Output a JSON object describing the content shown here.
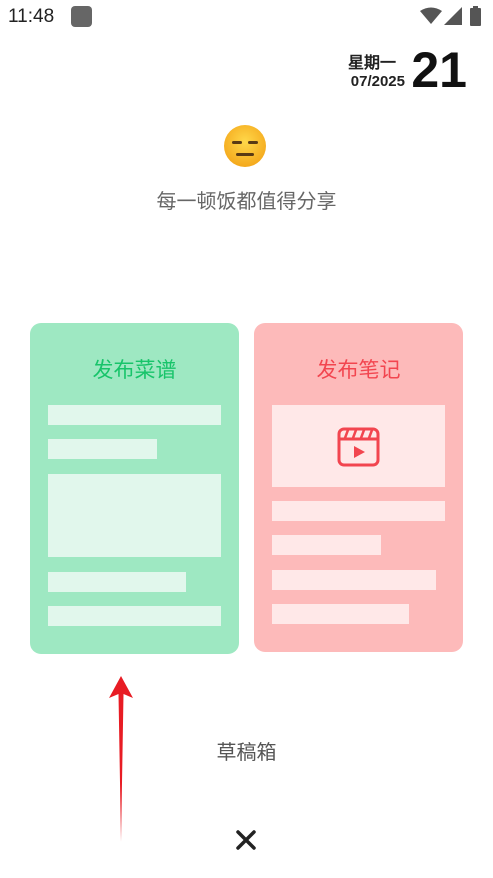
{
  "status_bar": {
    "time": "11:48",
    "icons": [
      "app-notification-icon",
      "wifi-icon",
      "signal-icon",
      "battery-icon"
    ]
  },
  "date": {
    "day_of_week": "星期一",
    "month_year": "07/2025",
    "day_number": "21"
  },
  "header": {
    "emoji": "expressionless-face-icon",
    "tagline": "每一顿饭都值得分享"
  },
  "cards": [
    {
      "title": "发布菜谱",
      "color": "#18c46a",
      "background": "#9ee8c2"
    },
    {
      "title": "发布笔记",
      "color": "#f2454f",
      "background": "#fdbaba",
      "icon": "video-icon"
    }
  ],
  "drafts": {
    "label": "草稿箱"
  },
  "close": {
    "icon": "close-icon"
  },
  "annotation": {
    "icon": "red-arrow-up-icon",
    "color": "#e81c24"
  }
}
